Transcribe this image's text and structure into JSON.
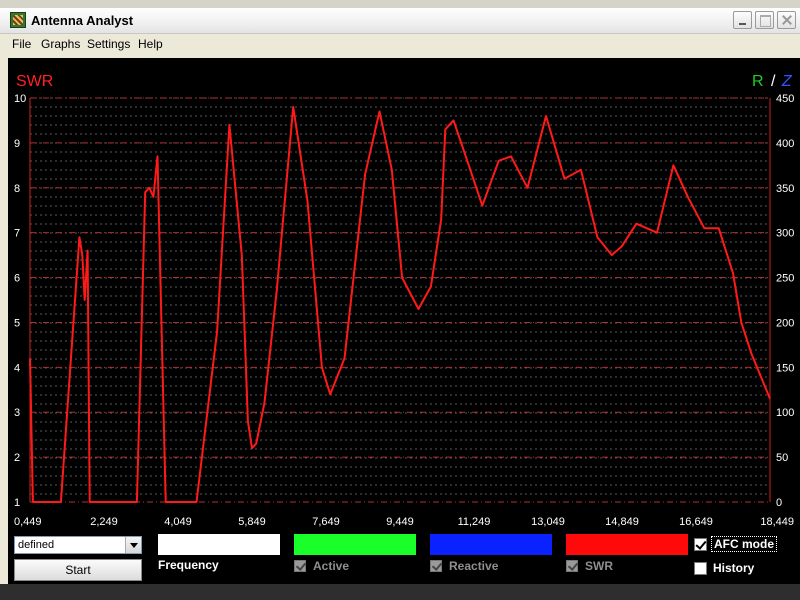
{
  "window": {
    "title": "Antenna Analyst",
    "icon": "antenna-analyst-app-icon"
  },
  "menu": {
    "items": [
      "File",
      "Graphs",
      "Settings",
      "Help"
    ]
  },
  "chart_data": {
    "type": "line",
    "left_axis_title": "SWR",
    "right_axis_title_r": "R",
    "right_axis_title_sep": "/",
    "right_axis_title_z": "Z",
    "y_left_ticks": [
      "10",
      "9",
      "8",
      "7",
      "6",
      "5",
      "4",
      "3",
      "2",
      "1"
    ],
    "y_right_ticks": [
      "450",
      "400",
      "350",
      "300",
      "250",
      "200",
      "150",
      "100",
      "50",
      "0"
    ],
    "x_ticks": [
      "0,449",
      "2,249",
      "4,049",
      "5,849",
      "7,649",
      "9,449",
      "11,249",
      "13,049",
      "14,849",
      "16,649",
      "18,449"
    ],
    "xlim": [
      0.449,
      18.449
    ],
    "ylim_left": [
      1,
      10
    ],
    "ylim_right": [
      0,
      450
    ],
    "grid": true,
    "series": [
      {
        "color": "#ff1a1a",
        "x": [
          0.449,
          0.52,
          0.56,
          0.6,
          1.2,
          1.65,
          1.72,
          1.78,
          1.85,
          1.9,
          2.0,
          2.25,
          2.45,
          3.05,
          3.25,
          3.35,
          3.45,
          3.55,
          3.75,
          3.85,
          4.5,
          5.0,
          5.3,
          5.6,
          5.75,
          5.85,
          5.95,
          6.15,
          6.45,
          6.85,
          7.2,
          7.55,
          7.75,
          8.1,
          8.6,
          8.95,
          9.25,
          9.5,
          9.9,
          10.2,
          10.45,
          10.55,
          10.75,
          11.05,
          11.45,
          11.85,
          12.15,
          12.55,
          13.0,
          13.45,
          13.85,
          14.25,
          14.6,
          14.85,
          15.2,
          15.7,
          16.1,
          16.45,
          16.85,
          17.2,
          17.55,
          17.75,
          18.0,
          18.449
        ],
        "y": [
          4.2,
          1.0,
          1.0,
          1.0,
          1.0,
          6.9,
          6.5,
          5.5,
          6.6,
          1.0,
          1.0,
          1.0,
          1.0,
          1.0,
          7.9,
          8.0,
          7.8,
          8.7,
          1.0,
          1.0,
          1.0,
          4.8,
          9.4,
          6.5,
          2.8,
          2.2,
          2.3,
          3.2,
          5.7,
          9.8,
          7.7,
          4.0,
          3.4,
          4.2,
          8.3,
          9.7,
          8.4,
          6.0,
          5.3,
          5.8,
          7.3,
          9.3,
          9.5,
          8.7,
          7.6,
          8.6,
          8.7,
          8.0,
          9.6,
          8.2,
          8.4,
          6.9,
          6.5,
          6.7,
          7.2,
          7.0,
          8.5,
          7.8,
          7.1,
          7.1,
          6.1,
          5.0,
          4.3,
          3.3
        ]
      }
    ]
  },
  "controls": {
    "preset_select_value": "defined",
    "start_label": "Start",
    "frequency_label": "Frequency",
    "active_label": "Active",
    "reactive_label": "Reactive",
    "swr_label": "SWR",
    "afc_label": "AFC mode",
    "history_label": "History",
    "afc_checked": true,
    "history_checked": false,
    "active_checked": true,
    "reactive_checked": true,
    "swr_checked": true,
    "colors": {
      "frequency": "#ffffff",
      "active": "#1aff2a",
      "reactive": "#0a22ff",
      "swr": "#ff0a0a"
    }
  }
}
